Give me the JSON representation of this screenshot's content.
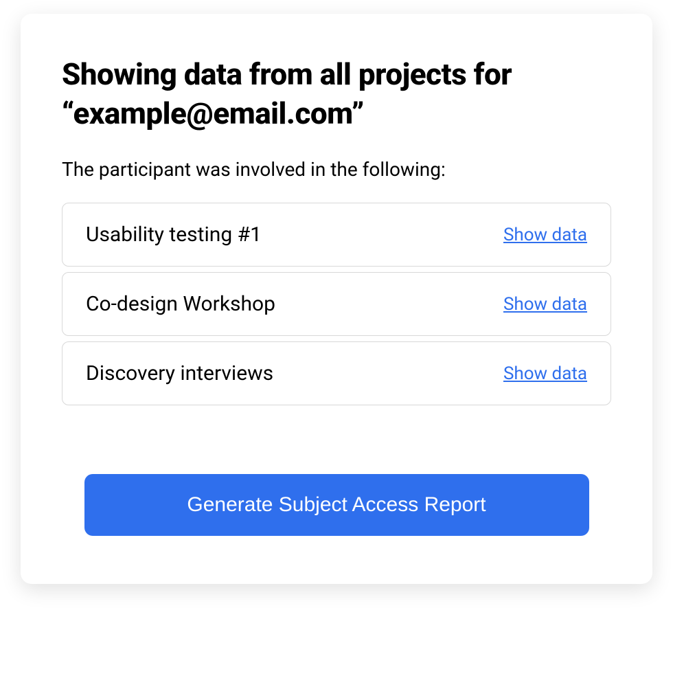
{
  "header": {
    "title": "Showing data from all projects for “example@email.com”"
  },
  "subtitle": "The participant was involved in the following:",
  "projects": [
    {
      "name": "Usability testing #1",
      "action_label": "Show data"
    },
    {
      "name": "Co-design Workshop",
      "action_label": "Show data"
    },
    {
      "name": "Discovery interviews",
      "action_label": "Show data"
    }
  ],
  "primary_action": {
    "label": "Generate Subject Access Report"
  }
}
